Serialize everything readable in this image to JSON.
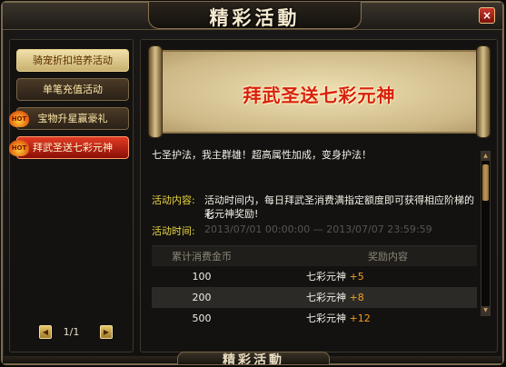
{
  "window": {
    "title": "精彩活動",
    "close_label": "×",
    "bottom_title": "精彩活動"
  },
  "sidebar": {
    "items": [
      {
        "label": "骑宠折扣培养活动",
        "state": "gold",
        "hot": false
      },
      {
        "label": "单笔充值活动",
        "state": "normal",
        "hot": false
      },
      {
        "label": "宝物升星赢豪礼",
        "state": "normal",
        "hot": true
      },
      {
        "label": "拜武圣送七彩元神",
        "state": "active",
        "hot": true
      }
    ],
    "hot_badge_label": "HOT",
    "pager": {
      "text": "1/1",
      "prev_icon": "◀",
      "next_icon": "▶"
    }
  },
  "detail": {
    "banner_title": "拜武圣送七彩元神",
    "description": "七圣护法，我主群雄！超高属性加成，变身护法！",
    "content_label": "活动内容:",
    "content_text_1": "活动时间内，每日拜武圣消费满指定额度即可获得相应阶梯的七",
    "content_text_2": "彩元神奖励!",
    "time_label": "活动时间:",
    "time_value": "2013/07/01 00:00:00 — 2013/07/07 23:59:59",
    "table": {
      "headers": [
        "累计消费金币",
        "奖励内容"
      ],
      "rows": [
        {
          "amount": "100",
          "reward": "七彩元神",
          "bonus": "+5"
        },
        {
          "amount": "200",
          "reward": "七彩元神",
          "bonus": "+8"
        },
        {
          "amount": "500",
          "reward": "七彩元神",
          "bonus": "+12"
        }
      ]
    },
    "scrollbar": {
      "up_icon": "▲",
      "down_icon": "▼"
    }
  },
  "colors": {
    "accent_gold": "#e8d640",
    "active_red": "#e23b23",
    "bonus_orange": "#f0a020"
  }
}
